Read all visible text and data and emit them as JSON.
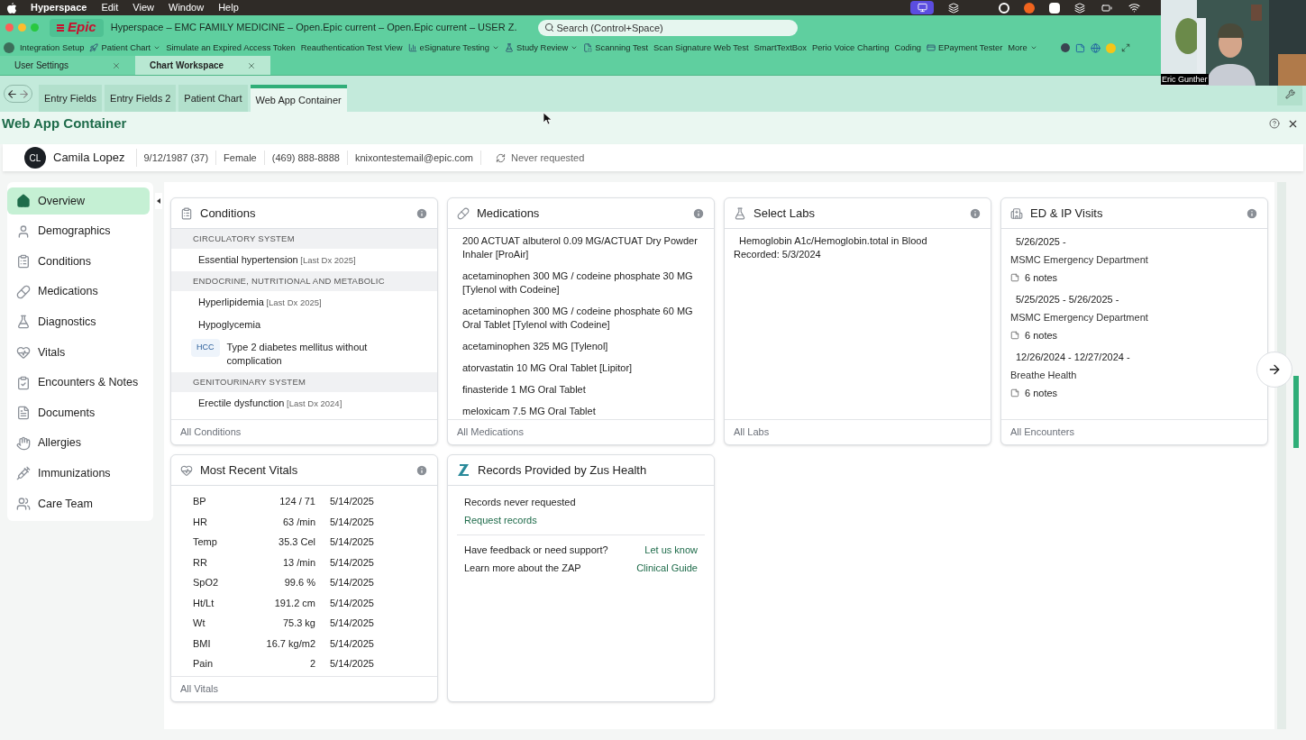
{
  "menu_bar": {
    "app": "Hyperspace",
    "items": [
      "Edit",
      "View",
      "Window",
      "Help"
    ]
  },
  "title_bar": {
    "logo": "Epic",
    "title": "Hyperspace – EMC FAMILY MEDICINE – Open.Epic current – Open.Epic current – USER Z.",
    "search": {
      "placeholder": "Search (Control+Space)"
    }
  },
  "toolbar": [
    {
      "label": "Integration Setup",
      "dropdown": false
    },
    {
      "label": "Patient Chart",
      "dropdown": true
    },
    {
      "label": "Simulate an Expired Access Token",
      "dropdown": false
    },
    {
      "label": "Reauthentication Test View",
      "dropdown": false
    },
    {
      "label": "eSignature Testing",
      "dropdown": true
    },
    {
      "label": "Study Review",
      "dropdown": true
    },
    {
      "label": "Scanning Test",
      "dropdown": false
    },
    {
      "label": "Scan Signature Web Test",
      "dropdown": false
    },
    {
      "label": "SmartTextBox",
      "dropdown": false
    },
    {
      "label": "Perio Voice Charting",
      "dropdown": false
    },
    {
      "label": "Coding",
      "dropdown": false
    },
    {
      "label": "EPayment Tester",
      "dropdown": false
    },
    {
      "label": "More",
      "dropdown": true
    }
  ],
  "workspace_tabs": [
    {
      "label": "User Settings",
      "selected": false
    },
    {
      "label": "Chart Workspace",
      "selected": true
    }
  ],
  "activity_tabs": [
    {
      "label": "Entry Fields",
      "selected": false
    },
    {
      "label": "Entry Fields 2",
      "selected": false
    },
    {
      "label": "Patient Chart",
      "selected": false
    },
    {
      "label": "Web App Container",
      "selected": true
    }
  ],
  "page_title": "Web App Container",
  "patient": {
    "initials": "CL",
    "name": "Camila Lopez",
    "fields": [
      "9/12/1987 (37)",
      "Female",
      "(469) 888-8888",
      "knixontestemail@epic.com"
    ],
    "records_status": "Never requested"
  },
  "sidebar": [
    {
      "label": "Overview",
      "selected": true
    },
    {
      "label": "Demographics",
      "selected": false
    },
    {
      "label": "Conditions",
      "selected": false
    },
    {
      "label": "Medications",
      "selected": false
    },
    {
      "label": "Diagnostics",
      "selected": false
    },
    {
      "label": "Vitals",
      "selected": false
    },
    {
      "label": "Encounters & Notes",
      "selected": false
    },
    {
      "label": "Documents",
      "selected": false
    },
    {
      "label": "Allergies",
      "selected": false
    },
    {
      "label": "Immunizations",
      "selected": false
    },
    {
      "label": "Care Team",
      "selected": false
    }
  ],
  "conditions": {
    "title": "Conditions",
    "footer": "All Conditions",
    "groups": [
      {
        "heading": "CIRCULATORY SYSTEM",
        "items": [
          {
            "name": "Essential hypertension",
            "note": "[Last Dx 2025]"
          }
        ]
      },
      {
        "heading": "ENDOCRINE, NUTRITIONAL AND METABOLIC",
        "items": [
          {
            "name": "Hyperlipidemia",
            "note": "[Last Dx 2025]"
          },
          {
            "name": "Hypoglycemia"
          },
          {
            "name": "Type 2 diabetes mellitus without complication",
            "badge": "HCC"
          }
        ]
      },
      {
        "heading": "GENITOURINARY SYSTEM",
        "items": [
          {
            "name": "Erectile dysfunction",
            "note": "[Last Dx 2024]"
          }
        ]
      }
    ]
  },
  "medications": {
    "title": "Medications",
    "footer": "All Medications",
    "items": [
      "200 ACTUAT albuterol 0.09 MG/ACTUAT Dry Powder Inhaler [ProAir]",
      "acetaminophen 300 MG / codeine phosphate 30 MG [Tylenol with Codeine]",
      "acetaminophen 300 MG / codeine phosphate 60 MG Oral Tablet [Tylenol with Codeine]",
      "acetaminophen 325 MG [Tylenol]",
      "atorvastatin 10 MG Oral Tablet [Lipitor]",
      "finasteride 1 MG Oral Tablet",
      "meloxicam 7.5 MG Oral Tablet"
    ]
  },
  "labs": {
    "title": "Select Labs",
    "footer": "All Labs",
    "items": [
      {
        "name": "Hemoglobin A1c/Hemoglobin.total",
        "specimen": "in Blood",
        "recorded": "Recorded: 5/3/2024"
      }
    ]
  },
  "visits": {
    "title": "ED & IP Visits",
    "footer": "All Encounters",
    "items": [
      {
        "dates": "5/26/2025 -",
        "place": "MSMC Emergency Department",
        "notes": "6 notes"
      },
      {
        "dates": "5/25/2025 - 5/26/2025 -",
        "place": "MSMC Emergency Department",
        "notes": "6 notes"
      },
      {
        "dates": "12/26/2024 - 12/27/2024 -",
        "place": "Breathe Health",
        "notes": "6 notes"
      }
    ]
  },
  "vitals": {
    "title": "Most Recent Vitals",
    "footer": "All Vitals",
    "rows": [
      {
        "name": "BP",
        "value": "124 / 71",
        "date": "5/14/2025"
      },
      {
        "name": "HR",
        "value": "63 /min",
        "date": "5/14/2025"
      },
      {
        "name": "Temp",
        "value": "35.3 Cel",
        "date": "5/14/2025"
      },
      {
        "name": "RR",
        "value": "13 /min",
        "date": "5/14/2025"
      },
      {
        "name": "SpO2",
        "value": "99.6 %",
        "date": "5/14/2025"
      },
      {
        "name": "Ht/Lt",
        "value": "191.2 cm",
        "date": "5/14/2025"
      },
      {
        "name": "Wt",
        "value": "75.3 kg",
        "date": "5/14/2025"
      },
      {
        "name": "BMI",
        "value": "16.7 kg/m2",
        "date": "5/14/2025"
      },
      {
        "name": "Pain",
        "value": "2",
        "date": "5/14/2025"
      }
    ]
  },
  "zus": {
    "title": "Records Provided by Zus Health",
    "status": "Records never requested",
    "action": "Request records",
    "links": [
      {
        "text": "Have feedback or need support?",
        "link": "Let us know"
      },
      {
        "text": "Learn more about the ZAP",
        "link": "Clinical Guide"
      }
    ]
  },
  "video_overlay": {
    "caption": "Eric Gunther"
  }
}
